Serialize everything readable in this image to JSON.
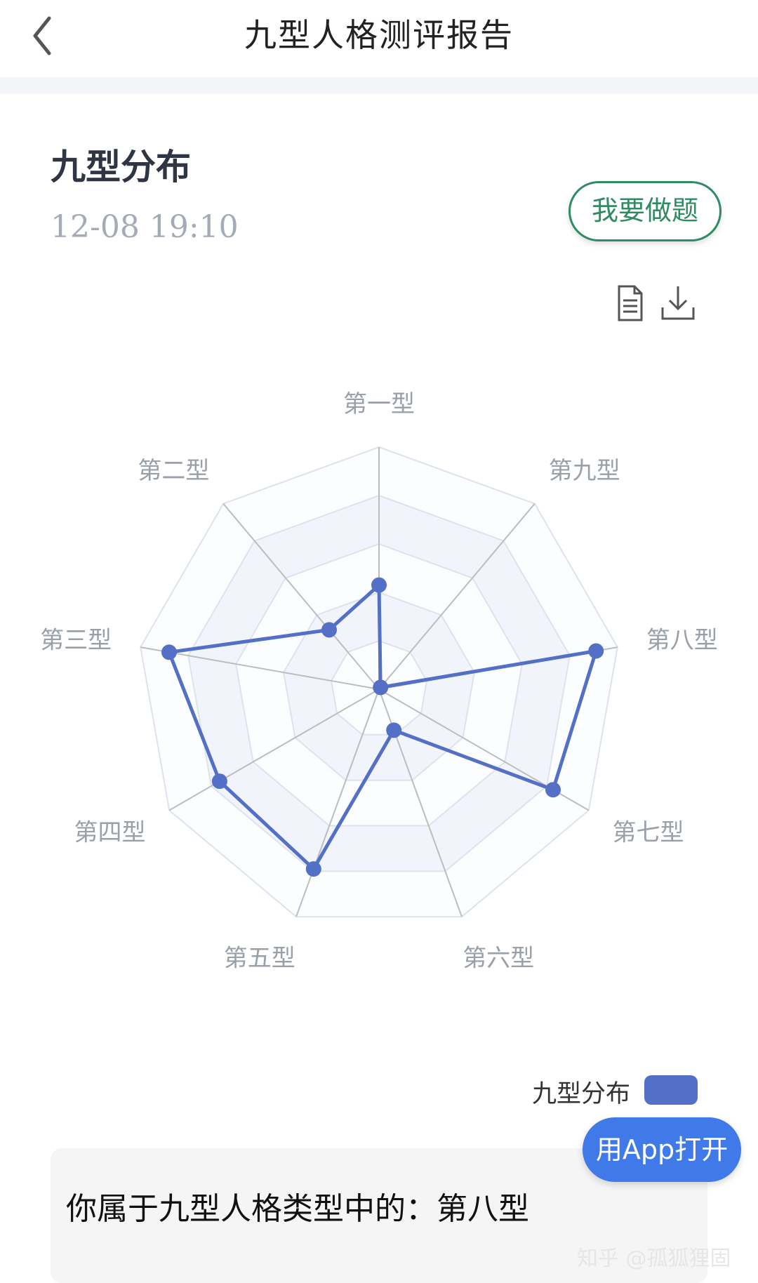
{
  "header": {
    "title": "九型人格测评报告"
  },
  "section": {
    "title": "九型分布",
    "timestamp": "12-08 19:10",
    "do_quiz_label": "我要做题"
  },
  "toolbar": {
    "icons": [
      "document-icon",
      "download-icon"
    ]
  },
  "chart_data": {
    "type": "radar",
    "indicators": [
      "第一型",
      "第二型",
      "第三型",
      "第四型",
      "第五型",
      "第六型",
      "第七型",
      "第八型",
      "第九型"
    ],
    "max": 10,
    "series": [
      {
        "name": "九型分布",
        "values": [
          4.3,
          3.2,
          8.8,
          7.6,
          7.9,
          1.8,
          8.3,
          9.1,
          0.1
        ],
        "color": "#5470c6"
      }
    ],
    "legend_position": "bottom-right",
    "split_levels": 5
  },
  "result": {
    "text": "你属于九型人格类型中的：第八型"
  },
  "app_button": {
    "label": "用App打开"
  },
  "watermark": {
    "text": "知乎 @孤狐狸固"
  }
}
